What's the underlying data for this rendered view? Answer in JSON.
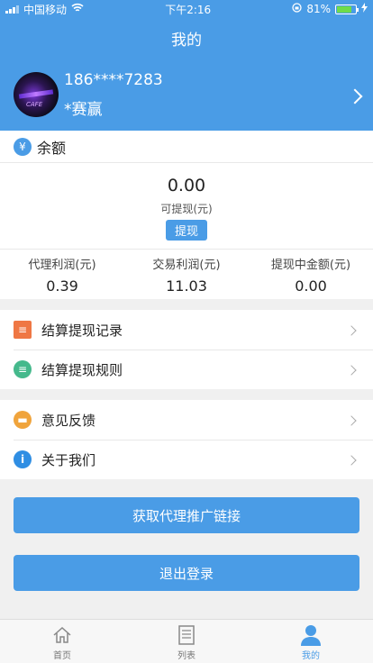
{
  "status_bar": {
    "carrier": "中国移动",
    "time": "下午2:16",
    "battery": "81%",
    "battery_level": 0.81
  },
  "navbar": {
    "title": "我的"
  },
  "profile": {
    "avatar_text": "CAFE",
    "phone": "186****7283",
    "name": "*赛赢"
  },
  "balance": {
    "title": "余额",
    "amount": "0.00",
    "available_label": "可提现(元)",
    "withdraw_button": "提现",
    "stats": [
      {
        "label": "代理利润(元)",
        "value": "0.39"
      },
      {
        "label": "交易利润(元)",
        "value": "11.03"
      },
      {
        "label": "提现中金额(元)",
        "value": "0.00"
      }
    ]
  },
  "menu_group1": [
    {
      "label": "结算提现记录",
      "icon": "document-icon"
    },
    {
      "label": "结算提现规则",
      "icon": "rules-icon"
    }
  ],
  "menu_group2": [
    {
      "label": "意见反馈",
      "icon": "feedback-icon"
    },
    {
      "label": "关于我们",
      "icon": "info-icon"
    }
  ],
  "buttons": {
    "get_link": "获取代理推广链接",
    "logout": "退出登录"
  },
  "tabbar": [
    {
      "label": "首页",
      "icon": "home-icon"
    },
    {
      "label": "列表",
      "icon": "list-icon"
    },
    {
      "label": "我的",
      "icon": "user-icon",
      "active": true
    }
  ],
  "colors": {
    "primary": "#4a9ce6",
    "background": "#f0f0f0"
  }
}
